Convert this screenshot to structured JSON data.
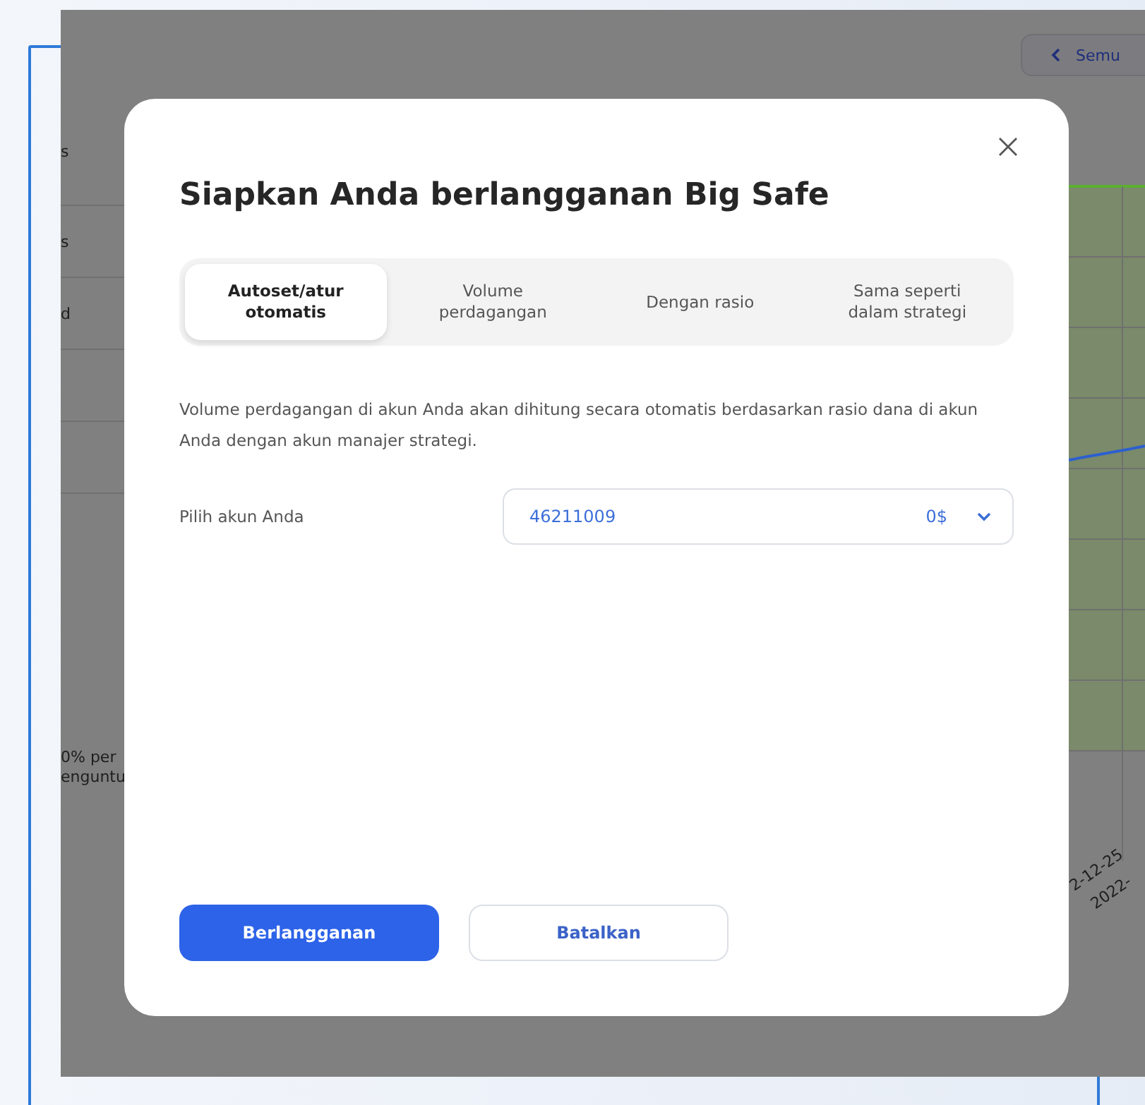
{
  "background": {
    "back_button": {
      "label": "Semu"
    },
    "side_labels": [
      "s",
      "s",
      "d"
    ],
    "note_lines": [
      "0% per",
      "enguntu"
    ],
    "axis_labels": [
      "2-12-25",
      "2022-"
    ]
  },
  "dialog": {
    "title": "Siapkan Anda berlangganan Big Safe",
    "tabs": [
      {
        "label": "Autoset/atur otomatis",
        "selected": true
      },
      {
        "label": "Volume perdagangan",
        "selected": false
      },
      {
        "label": "Dengan rasio",
        "selected": false
      },
      {
        "label": "Sama seperti dalam strategi",
        "selected": false
      }
    ],
    "description": "Volume perdagangan di akun Anda akan dihitung secara otomatis berdasarkan rasio dana di akun Anda dengan akun manajer strategi.",
    "account_field": {
      "label": "Pilih akun Anda",
      "value": "46211009",
      "balance": "0$"
    },
    "buttons": [
      {
        "label": "Berlangganan",
        "kind": "primary"
      },
      {
        "label": "Batalkan",
        "kind": "secondary"
      }
    ]
  }
}
